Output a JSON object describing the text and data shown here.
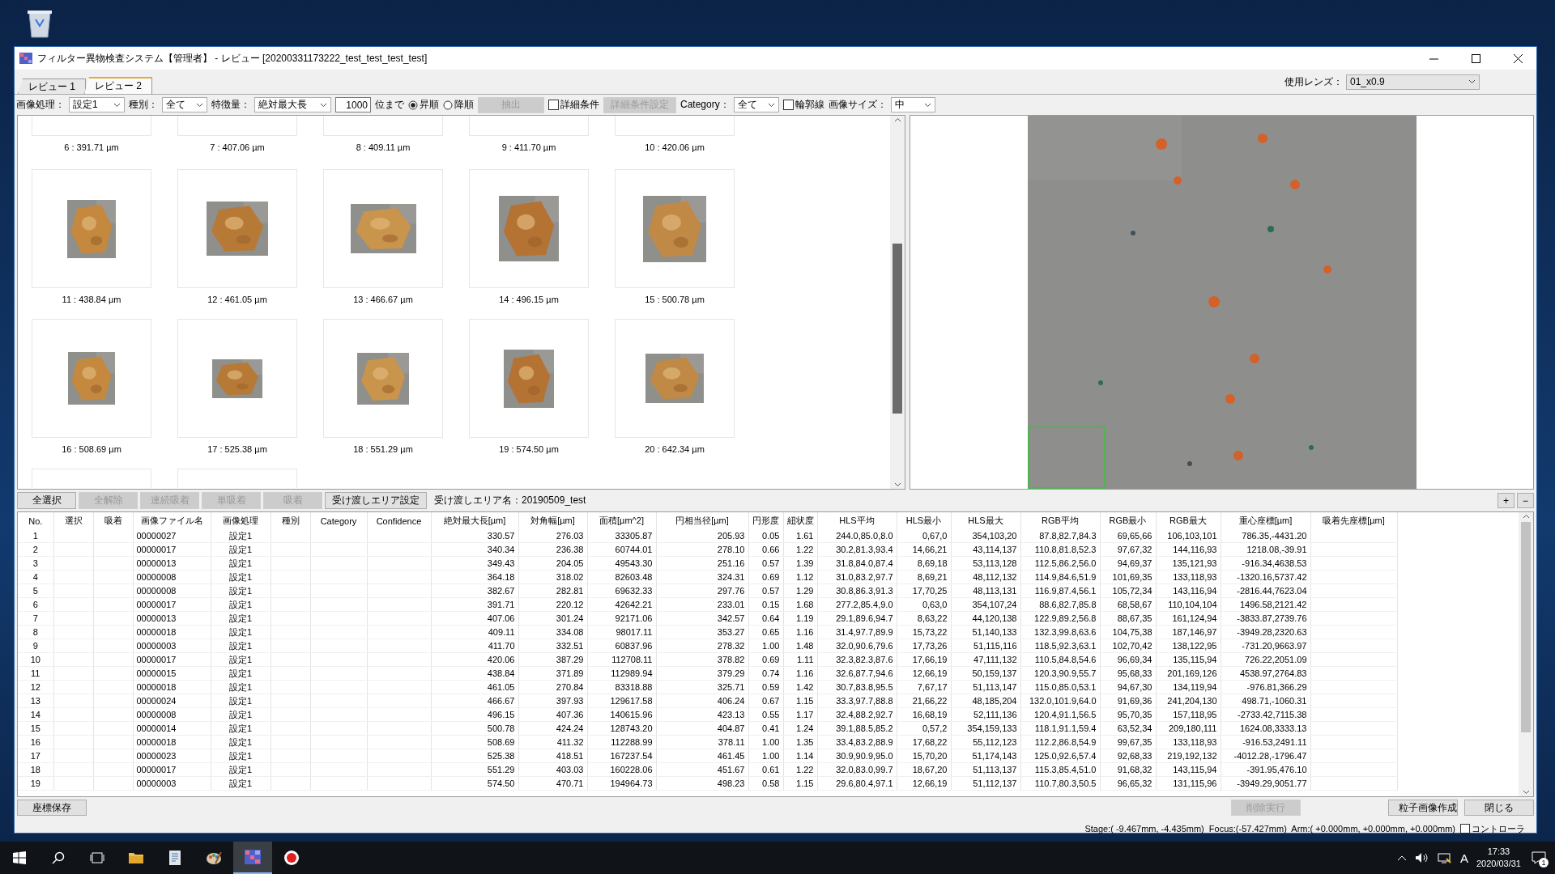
{
  "window": {
    "title": "フィルター異物検査システム【管理者】 - レビュー [20200331173222_test_test_test_test]"
  },
  "tabs": [
    {
      "label": "レビュー 1",
      "selected": false
    },
    {
      "label": "レビュー 2",
      "selected": true
    }
  ],
  "lens": {
    "label": "使用レンズ：",
    "value": "01_x0.9"
  },
  "toolbar": [
    {
      "kind": "select",
      "label": "画像処理：",
      "value": "設定1"
    },
    {
      "kind": "select",
      "label": "種別：",
      "value": "全て"
    },
    {
      "kind": "select",
      "label": "特徴量：",
      "value": "絶対最大長"
    },
    {
      "kind": "input",
      "value": "1000"
    },
    {
      "kind": "text",
      "label": "位まで"
    },
    {
      "kind": "radio",
      "label": "昇順",
      "selected": true
    },
    {
      "kind": "radio",
      "label": "降順",
      "selected": false
    },
    {
      "kind": "button",
      "label": "抽出",
      "disabled": true
    },
    {
      "kind": "checkbox",
      "label": "詳細条件",
      "checked": false
    },
    {
      "kind": "button",
      "label": "詳細条件設定",
      "disabled": true
    },
    {
      "kind": "select",
      "label": "Category：",
      "value": "全て"
    },
    {
      "kind": "checkbox",
      "label": "輪郭線",
      "checked": false
    },
    {
      "kind": "select",
      "label": "画像サイズ：",
      "value": "中"
    }
  ],
  "thumbnails": [
    {
      "kind": "cut_top",
      "label": "6 : 391.71 µm"
    },
    {
      "kind": "cut_top",
      "label": "7 : 407.06 µm"
    },
    {
      "kind": "cut_top",
      "label": "8 : 409.11 µm"
    },
    {
      "kind": "cut_top",
      "label": "9 : 411.70 µm"
    },
    {
      "kind": "cut_top",
      "label": "10 : 420.06 µm"
    },
    {
      "kind": "full",
      "label": "11 : 438.84 µm"
    },
    {
      "kind": "full",
      "label": "12 : 461.05 µm"
    },
    {
      "kind": "full",
      "label": "13 : 466.67 µm"
    },
    {
      "kind": "full",
      "label": "14 : 496.15 µm"
    },
    {
      "kind": "full",
      "label": "15 : 500.78 µm"
    },
    {
      "kind": "full",
      "label": "16 : 508.69 µm"
    },
    {
      "kind": "full",
      "label": "17 : 525.38 µm"
    },
    {
      "kind": "full",
      "label": "18 : 551.29 µm"
    },
    {
      "kind": "full",
      "label": "19 : 574.50 µm"
    },
    {
      "kind": "full",
      "label": "20 : 642.34 µm"
    },
    {
      "kind": "cut_bottom"
    },
    {
      "kind": "cut_bottom"
    }
  ],
  "actions": [
    {
      "label": "全選択",
      "disabled": false
    },
    {
      "label": "全解除",
      "disabled": true
    },
    {
      "label": "連続吸着",
      "disabled": true
    },
    {
      "label": "単吸着",
      "disabled": true
    },
    {
      "label": "吸着",
      "disabled": true
    },
    {
      "label": "受け渡しエリア設定",
      "disabled": false
    }
  ],
  "transfer_area": "受け渡しエリア名：20190509_test",
  "zoom_buttons": [
    "+",
    "−"
  ],
  "table": {
    "columns": [
      {
        "label": "No.",
        "kind": "center"
      },
      {
        "label": "選択"
      },
      {
        "label": "吸着"
      },
      {
        "label": "画像ファイル名",
        "kind": "text"
      },
      {
        "label": "画像処理",
        "kind": "center"
      },
      {
        "label": "種別"
      },
      {
        "label": "Category"
      },
      {
        "label": "Confidence"
      },
      {
        "label": "絶対最大長[µm]",
        "kind": "number"
      },
      {
        "label": "対角幅[µm]",
        "kind": "number"
      },
      {
        "label": "面積[µm^2]",
        "kind": "number"
      },
      {
        "label": "円相当径[µm]",
        "kind": "number"
      },
      {
        "label": "円形度",
        "kind": "number"
      },
      {
        "label": "紐状度",
        "kind": "number"
      },
      {
        "label": "HLS平均",
        "kind": "number"
      },
      {
        "label": "HLS最小",
        "kind": "number"
      },
      {
        "label": "HLS最大",
        "kind": "number"
      },
      {
        "label": "RGB平均",
        "kind": "number"
      },
      {
        "label": "RGB最小",
        "kind": "number"
      },
      {
        "label": "RGB最大",
        "kind": "number"
      },
      {
        "label": "重心座標[µm]",
        "kind": "number"
      },
      {
        "label": "吸着先座標[µm]"
      }
    ],
    "rows": [
      [
        "1",
        "",
        "",
        "00000027",
        "設定1",
        "",
        "",
        "",
        "330.57",
        "276.03",
        "33305.87",
        "205.93",
        "0.05",
        "1.61",
        "244.0,85.0,8.0",
        "0,67,0",
        "354,103,20",
        "87.8,82.7,84.3",
        "69,65,66",
        "106,103,101",
        "786.35,-4431.20",
        ""
      ],
      [
        "2",
        "",
        "",
        "00000017",
        "設定1",
        "",
        "",
        "",
        "340.34",
        "236.38",
        "60744.01",
        "278.10",
        "0.66",
        "1.22",
        "30.2,81.3,93.4",
        "14,66,21",
        "43,114,137",
        "110.8,81.8,52.3",
        "97,67,32",
        "144,116,93",
        "1218.08,-39.91",
        ""
      ],
      [
        "3",
        "",
        "",
        "00000013",
        "設定1",
        "",
        "",
        "",
        "349.43",
        "204.05",
        "49543.30",
        "251.16",
        "0.57",
        "1.39",
        "31.8,84.0,87.4",
        "8,69,18",
        "53,113,128",
        "112.5,86.2,56.0",
        "94,69,37",
        "135,121,93",
        "-916.34,4638.53",
        ""
      ],
      [
        "4",
        "",
        "",
        "00000008",
        "設定1",
        "",
        "",
        "",
        "364.18",
        "318.02",
        "82603.48",
        "324.31",
        "0.69",
        "1.12",
        "31.0,83.2,97.7",
        "8,69,21",
        "48,112,132",
        "114.9,84.6,51.9",
        "101,69,35",
        "133,118,93",
        "-1320.16,5737.42",
        ""
      ],
      [
        "5",
        "",
        "",
        "00000008",
        "設定1",
        "",
        "",
        "",
        "382.67",
        "282.81",
        "69632.33",
        "297.76",
        "0.57",
        "1.29",
        "30.8,86.3,91.3",
        "17,70,25",
        "48,113,131",
        "116.9,87.4,56.1",
        "105,72,34",
        "143,116,94",
        "-2816.44,7623.04",
        ""
      ],
      [
        "6",
        "",
        "",
        "00000017",
        "設定1",
        "",
        "",
        "",
        "391.71",
        "220.12",
        "42642.21",
        "233.01",
        "0.15",
        "1.68",
        "277.2,85.4,9.0",
        "0,63,0",
        "354,107,24",
        "88.6,82.7,85.8",
        "68,58,67",
        "110,104,104",
        "1496.58,2121.42",
        ""
      ],
      [
        "7",
        "",
        "",
        "00000013",
        "設定1",
        "",
        "",
        "",
        "407.06",
        "301.24",
        "92171.06",
        "342.57",
        "0.64",
        "1.19",
        "29.1,89.6,94.7",
        "8,63,22",
        "44,120,138",
        "122.9,89.2,56.8",
        "88,67,35",
        "161,124,94",
        "-3833.87,2739.76",
        ""
      ],
      [
        "8",
        "",
        "",
        "00000018",
        "設定1",
        "",
        "",
        "",
        "409.11",
        "334.08",
        "98017.11",
        "353.27",
        "0.65",
        "1.16",
        "31.4,97.7,89.9",
        "15,73,22",
        "51,140,133",
        "132.3,99.8,63.6",
        "104,75,38",
        "187,146,97",
        "-3949.28,2320.63",
        ""
      ],
      [
        "9",
        "",
        "",
        "00000003",
        "設定1",
        "",
        "",
        "",
        "411.70",
        "332.51",
        "60837.96",
        "278.32",
        "1.00",
        "1.48",
        "32.0,90.6,79.6",
        "17,73,26",
        "51,115,116",
        "118.5,92.3,63.1",
        "102,70,42",
        "138,122,95",
        "-731.20,9663.97",
        ""
      ],
      [
        "10",
        "",
        "",
        "00000017",
        "設定1",
        "",
        "",
        "",
        "420.06",
        "387.29",
        "112708.11",
        "378.82",
        "0.69",
        "1.11",
        "32.3,82.3,87.6",
        "17,66,19",
        "47,111,132",
        "110.5,84.8,54.6",
        "96,69,34",
        "135,115,94",
        "726.22,2051.09",
        ""
      ],
      [
        "11",
        "",
        "",
        "00000015",
        "設定1",
        "",
        "",
        "",
        "438.84",
        "371.89",
        "112989.94",
        "379.29",
        "0.74",
        "1.16",
        "32.6,87.7,94.6",
        "12,66,19",
        "50,159,137",
        "120.3,90.9,55.7",
        "95,68,33",
        "201,169,126",
        "4538.97,2764.83",
        ""
      ],
      [
        "12",
        "",
        "",
        "00000018",
        "設定1",
        "",
        "",
        "",
        "461.05",
        "270.84",
        "83318.88",
        "325.71",
        "0.59",
        "1.42",
        "30.7,83.8,95.5",
        "7,67,17",
        "51,113,147",
        "115.0,85.0,53.1",
        "94,67,30",
        "134,119,94",
        "-976.81,366.29",
        ""
      ],
      [
        "13",
        "",
        "",
        "00000024",
        "設定1",
        "",
        "",
        "",
        "466.67",
        "397.93",
        "129617.58",
        "406.24",
        "0.67",
        "1.15",
        "33.3,97.7,88.8",
        "21,66,22",
        "48,185,204",
        "132.0,101.9,64.0",
        "91,69,36",
        "241,204,130",
        "498.71,-1060.31",
        ""
      ],
      [
        "14",
        "",
        "",
        "00000008",
        "設定1",
        "",
        "",
        "",
        "496.15",
        "407.36",
        "140615.96",
        "423.13",
        "0.55",
        "1.17",
        "32.4,88.2,92.7",
        "16,68,19",
        "52,111,136",
        "120.4,91.1,56.5",
        "95,70,35",
        "157,118,95",
        "-2733.42,7115.38",
        ""
      ],
      [
        "15",
        "",
        "",
        "00000014",
        "設定1",
        "",
        "",
        "",
        "500.78",
        "424.24",
        "128743.20",
        "404.87",
        "0.41",
        "1.24",
        "39.1,88.5,85.2",
        "0,57,2",
        "354,159,133",
        "118.1,91.1,59.4",
        "63,52,34",
        "209,180,111",
        "1624.08,3333.13",
        ""
      ],
      [
        "16",
        "",
        "",
        "00000018",
        "設定1",
        "",
        "",
        "",
        "508.69",
        "411.32",
        "112288.99",
        "378.11",
        "1.00",
        "1.35",
        "33.4,83.2,88.9",
        "17,68,22",
        "55,112,123",
        "112.2,86.8,54.9",
        "99,67,35",
        "133,118,93",
        "-916.53,2491.11",
        ""
      ],
      [
        "17",
        "",
        "",
        "00000023",
        "設定1",
        "",
        "",
        "",
        "525.38",
        "418.51",
        "167237.54",
        "461.45",
        "1.00",
        "1.14",
        "30.9,90.9,95.0",
        "15,70,20",
        "51,174,143",
        "125.0,92.6,57.4",
        "92,68,33",
        "219,192,132",
        "-4012.28,-1796.47",
        ""
      ],
      [
        "18",
        "",
        "",
        "00000017",
        "設定1",
        "",
        "",
        "",
        "551.29",
        "403.03",
        "160228.06",
        "451.67",
        "0.61",
        "1.22",
        "32.0,83.0,99.7",
        "18,67,20",
        "51,113,137",
        "115.3,85.4,51.0",
        "91,68,32",
        "143,115,94",
        "-391.95,476.10",
        ""
      ],
      [
        "19",
        "",
        "",
        "00000003",
        "設定1",
        "",
        "",
        "",
        "574.50",
        "470.71",
        "194964.73",
        "498.23",
        "0.58",
        "1.15",
        "29.6,80.4,97.1",
        "12,66,19",
        "51,112,137",
        "110.7,80.3,50.5",
        "96,65,32",
        "131,115,96",
        "-3949.29,9051.77",
        ""
      ]
    ]
  },
  "footer": {
    "left": [
      {
        "label": "座標保存",
        "disabled": false
      }
    ],
    "right": [
      {
        "label": "削除実行",
        "disabled": true
      },
      {
        "label": "粒子画像作成",
        "disabled": false
      },
      {
        "label": "閉じる",
        "disabled": false
      }
    ]
  },
  "status_bar": {
    "text": "Stage:( -9.467mm, -4.435mm)  Focus:(-57.427mm)  Arm:( +0.000mm, +0.000mm, +0.000mm)",
    "controller": {
      "label": "コントローラ",
      "checked": false
    }
  },
  "taskbar": {
    "apps": [
      {
        "kind": "search",
        "active": false
      },
      {
        "kind": "taskview",
        "active": false
      },
      {
        "kind": "folder",
        "active": false
      },
      {
        "kind": "document",
        "active": false
      },
      {
        "kind": "paint",
        "active": false
      },
      {
        "kind": "grid",
        "active": true
      },
      {
        "kind": "record",
        "active": false
      }
    ],
    "ime": "A",
    "time": "17:33",
    "date": "2020/03/31",
    "notifications": "1"
  }
}
